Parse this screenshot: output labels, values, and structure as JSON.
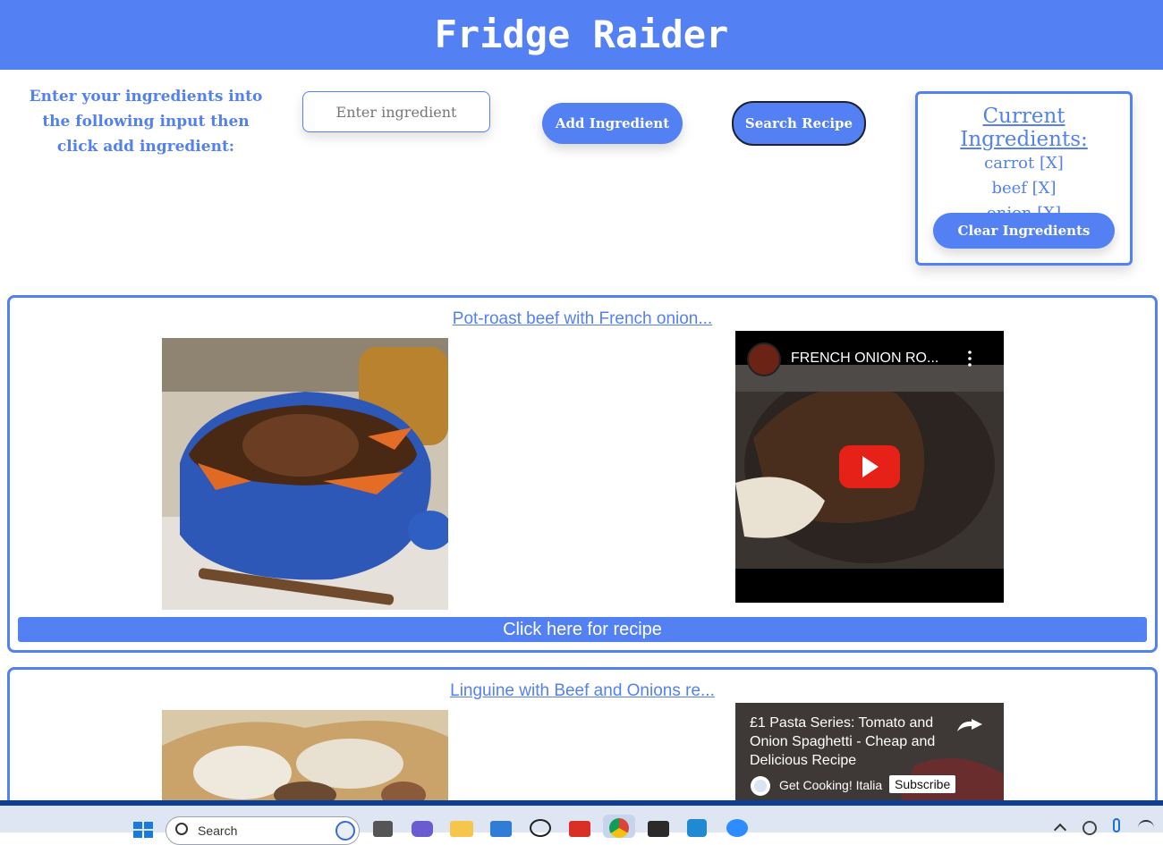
{
  "header": {
    "title": "Fridge Raider"
  },
  "form": {
    "instructions": "Enter your ingredients into the following input then click add ingredient:",
    "input_placeholder": "Enter ingredient",
    "add_label": "Add Ingredient",
    "search_label": "Search Recipe"
  },
  "current": {
    "title": "Current Ingredients:",
    "items": [
      "carrot [X]",
      "beef [X]",
      "onion [X]"
    ],
    "clear_label": "Clear Ingredients"
  },
  "results": [
    {
      "title": "Pot-roast beef with French onion...",
      "video_title": "FRENCH ONION RO...",
      "recipe_label": "Click here for recipe"
    },
    {
      "title": "Linguine with Beef and Onions re...",
      "video_title": "£1 Pasta Series: Tomato and Onion Spaghetti - Cheap and Delicious Recipe",
      "channel": "Get Cooking! Italia",
      "subscribe_label": "Subscribe"
    }
  ],
  "taskbar": {
    "search_placeholder": "Search"
  },
  "colors": {
    "accent": "#5380f2",
    "taskbar_border": "#0e3e95",
    "youtube_red": "#e62117"
  }
}
